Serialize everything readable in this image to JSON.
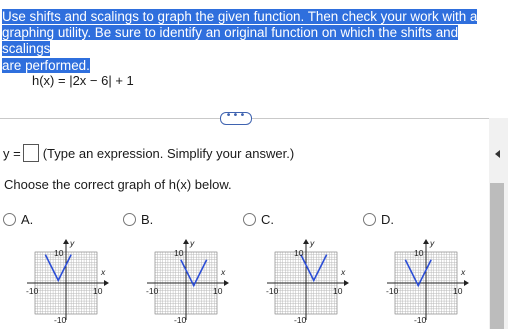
{
  "prompt": {
    "line1": "Use shifts and scalings to graph the given function. Then check your work with a",
    "line2": "graphing utility. Be sure to identify an original function on which the shifts and scalings",
    "line3": "are performed."
  },
  "function": {
    "text": "h(x) = |2x − 6| + 1"
  },
  "more_button": {
    "label": "•••"
  },
  "answer": {
    "prefix": "y =",
    "hint": "(Type an expression. Simplify your answer.)"
  },
  "choose_text": "Choose the correct graph of h(x) below.",
  "options": [
    {
      "label": "A.",
      "vertex": [
        -3,
        1
      ],
      "pts": [
        [
          -8,
          11
        ],
        [
          -3,
          1
        ],
        [
          2,
          11
        ]
      ],
      "tick_top": "10",
      "tick_bottom": "-10",
      "tick_left": "-10",
      "tick_right": "10",
      "ylabel": "y",
      "xlabel": "x"
    },
    {
      "label": "B.",
      "vertex": [
        3,
        -1
      ],
      "pts": [
        [
          -2,
          9
        ],
        [
          3,
          -1
        ],
        [
          8,
          9
        ]
      ],
      "tick_top": "10",
      "tick_bottom": "-10",
      "tick_left": "-10",
      "tick_right": "10",
      "ylabel": "y",
      "xlabel": "x"
    },
    {
      "label": "C.",
      "vertex": [
        3,
        1
      ],
      "pts": [
        [
          -2,
          11
        ],
        [
          3,
          1
        ],
        [
          8,
          11
        ]
      ],
      "tick_top": "10",
      "tick_bottom": "-10",
      "tick_left": "-10",
      "tick_right": "10",
      "ylabel": "y",
      "xlabel": "x"
    },
    {
      "label": "D.",
      "vertex": [
        -3,
        -1
      ],
      "pts": [
        [
          -8,
          9
        ],
        [
          -3,
          -1
        ],
        [
          2,
          9
        ]
      ],
      "tick_top": "10",
      "tick_bottom": "-10",
      "tick_left": "-10",
      "tick_right": "10",
      "ylabel": "y",
      "xlabel": "x"
    }
  ],
  "colors": {
    "highlight": "#2f6fdd",
    "curve": "#2d4fd6",
    "grid": "#b8b8b8"
  }
}
